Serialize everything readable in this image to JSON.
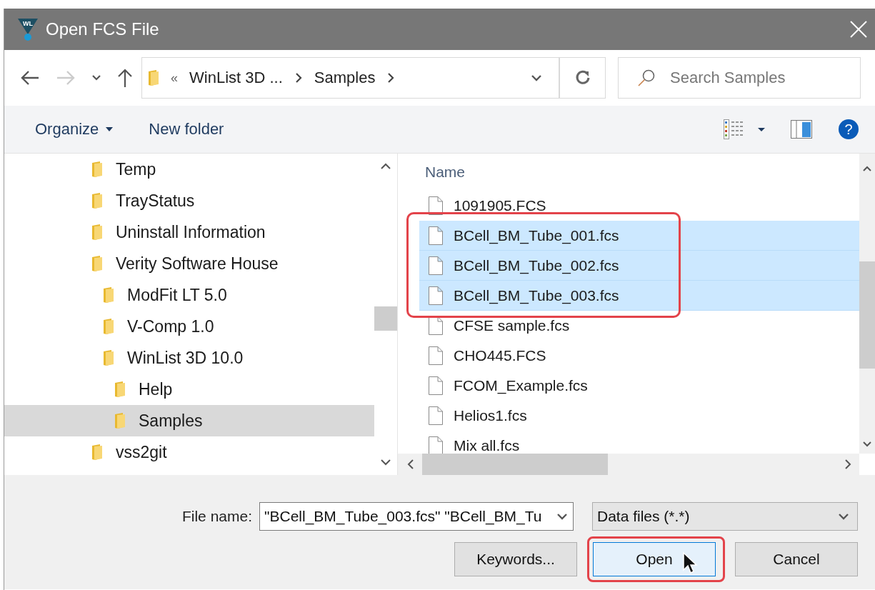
{
  "window": {
    "title": "Open FCS File",
    "logo_text": "WL"
  },
  "help": {
    "glyph": "?"
  },
  "address": {
    "overflow": "«",
    "crumbs": [
      "WinList 3D ...",
      "Samples"
    ]
  },
  "search": {
    "placeholder": "Search Samples"
  },
  "toolbar": {
    "organize": "Organize",
    "new_folder": "New folder"
  },
  "tree": [
    {
      "label": "Temp",
      "selected": false
    },
    {
      "label": "TrayStatus",
      "selected": false
    },
    {
      "label": "Uninstall Information",
      "selected": false
    },
    {
      "label": "Verity Software House",
      "selected": false,
      "children": [
        {
          "label": "ModFit LT 5.0",
          "selected": false
        },
        {
          "label": "V-Comp 1.0",
          "selected": false
        },
        {
          "label": "WinList 3D 10.0",
          "selected": false,
          "children": [
            {
              "label": "Help",
              "selected": false
            },
            {
              "label": "Samples",
              "selected": true
            }
          ]
        }
      ]
    },
    {
      "label": "vss2git",
      "selected": false
    }
  ],
  "files": {
    "column": "Name",
    "rows": [
      {
        "name": "1091905.FCS",
        "selected": false
      },
      {
        "name": "BCell_BM_Tube_001.fcs",
        "selected": true
      },
      {
        "name": "BCell_BM_Tube_002.fcs",
        "selected": true
      },
      {
        "name": "BCell_BM_Tube_003.fcs",
        "selected": true
      },
      {
        "name": "CFSE sample.fcs",
        "selected": false
      },
      {
        "name": "CHO445.FCS",
        "selected": false
      },
      {
        "name": "FCOM_Example.fcs",
        "selected": false
      },
      {
        "name": "Helios1.fcs",
        "selected": false
      },
      {
        "name": "Mix all.fcs",
        "selected": false
      }
    ]
  },
  "footer": {
    "file_name_label": "File name:",
    "file_name": "\"BCell_BM_Tube_003.fcs\" \"BCell_BM_Tu",
    "file_type": "Data files (*.*)",
    "buttons": [
      {
        "label": "Keywords...",
        "kind": "plain"
      },
      {
        "label": "Open",
        "kind": "highlighted"
      },
      {
        "label": "Cancel",
        "kind": "plain"
      }
    ]
  }
}
